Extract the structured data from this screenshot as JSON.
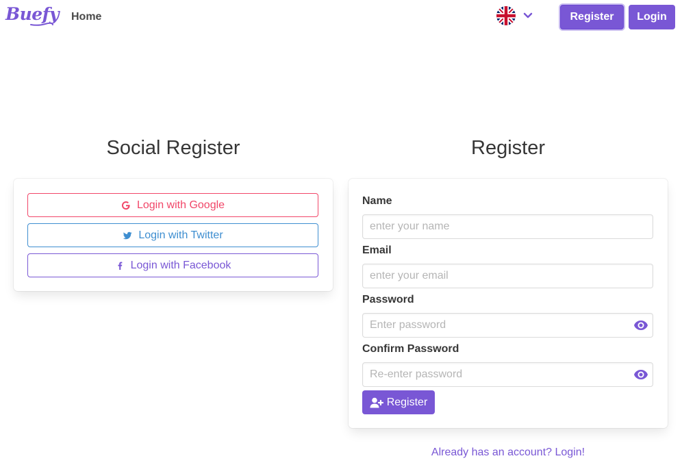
{
  "navbar": {
    "logo_text": "Buefy",
    "home_label": "Home",
    "language_icon": "uk-flag-icon",
    "register_label": "Register",
    "login_label": "Login"
  },
  "social": {
    "title": "Social Register",
    "google_label": "Login with Google",
    "twitter_label": "Login with Twitter",
    "facebook_label": "Login with Facebook"
  },
  "register": {
    "title": "Register",
    "name_label": "Name",
    "name_placeholder": "enter your name",
    "name_value": "",
    "email_label": "Email",
    "email_placeholder": "enter your email",
    "email_value": "",
    "password_label": "Password",
    "password_placeholder": "Enter password",
    "password_value": "",
    "confirm_label": "Confirm Password",
    "confirm_placeholder": "Re-enter password",
    "confirm_value": "",
    "submit_label": "Register",
    "already_link": "Already has an account? Login!"
  },
  "colors": {
    "primary": "#7957d5",
    "google": "#f14668",
    "twitter": "#3e8ed0"
  }
}
